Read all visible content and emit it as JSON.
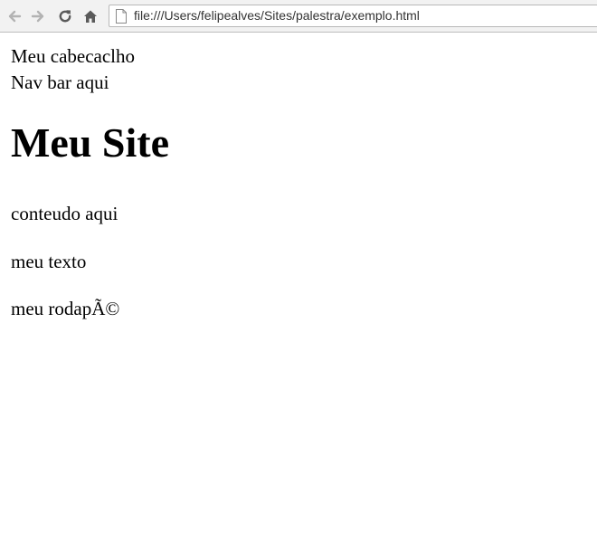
{
  "browser": {
    "url": "file:///Users/felipealves/Sites/palestra/exemplo.html",
    "icons": {
      "back": "back-arrow-icon",
      "forward": "forward-arrow-icon",
      "reload": "reload-icon",
      "home": "home-icon",
      "page": "page-icon"
    }
  },
  "page": {
    "header": "Meu cabecaclho",
    "nav": "Nav bar aqui",
    "title": "Meu Site",
    "content": "conteudo aqui",
    "text": "meu texto",
    "footer": "meu rodapÃ©"
  }
}
